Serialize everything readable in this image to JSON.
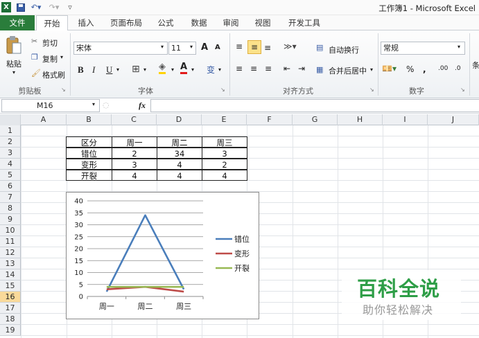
{
  "window": {
    "title": "工作簿1 - Microsoft Excel"
  },
  "quick_access": {
    "save_icon": "save-icon",
    "undo_icon": "undo-icon",
    "redo_icon": "redo-icon"
  },
  "tabs": [
    "文件",
    "开始",
    "插入",
    "页面布局",
    "公式",
    "数据",
    "审阅",
    "视图",
    "开发工具"
  ],
  "ribbon": {
    "clipboard": {
      "paste": "粘贴",
      "cut": "剪切",
      "copy": "复制",
      "format_painter": "格式刷",
      "label": "剪贴板"
    },
    "font": {
      "name": "宋体",
      "size": "11",
      "label": "字体",
      "grow": "A",
      "shrink": "A",
      "bold": "B",
      "italic": "I",
      "underline": "U",
      "wen": "变"
    },
    "alignment": {
      "wrap": "自动换行",
      "merge": "合并后居中",
      "label": "对齐方式"
    },
    "number": {
      "format": "常规",
      "percent": "%",
      "comma": ",",
      "inc": ".00",
      "dec": ".0",
      "label": "数字"
    },
    "styles": {
      "partial": "条"
    }
  },
  "formula_bar": {
    "name_box": "M16",
    "fx": "fx",
    "value": ""
  },
  "columns": [
    "A",
    "B",
    "C",
    "D",
    "E",
    "F",
    "G",
    "H",
    "I",
    "J"
  ],
  "rows": [
    "1",
    "2",
    "3",
    "4",
    "5",
    "6",
    "7",
    "8",
    "9",
    "10",
    "11",
    "12",
    "13",
    "14",
    "15",
    "16",
    "17",
    "18",
    "19"
  ],
  "selected_row": "16",
  "table": {
    "header": [
      "区分",
      "周一",
      "周二",
      "周三"
    ],
    "rows": [
      [
        "错位",
        "2",
        "34",
        "3"
      ],
      [
        "变形",
        "3",
        "4",
        "2"
      ],
      [
        "开裂",
        "4",
        "4",
        "4"
      ]
    ]
  },
  "chart_data": {
    "type": "line",
    "categories": [
      "周一",
      "周二",
      "周三"
    ],
    "series": [
      {
        "name": "错位",
        "values": [
          2,
          34,
          3
        ],
        "color": "#4a7ebb"
      },
      {
        "name": "变形",
        "values": [
          3,
          4,
          2
        ],
        "color": "#be4b48"
      },
      {
        "name": "开裂",
        "values": [
          4,
          4,
          4
        ],
        "color": "#98b954"
      }
    ],
    "yticks": [
      "0",
      "5",
      "10",
      "15",
      "20",
      "25",
      "30",
      "35",
      "40"
    ],
    "ylim": [
      0,
      40
    ],
    "grid": true,
    "legend": "right"
  },
  "watermark": {
    "title": "百科全说",
    "subtitle": "助你轻松解决",
    "title_color": "#2e9e47"
  }
}
